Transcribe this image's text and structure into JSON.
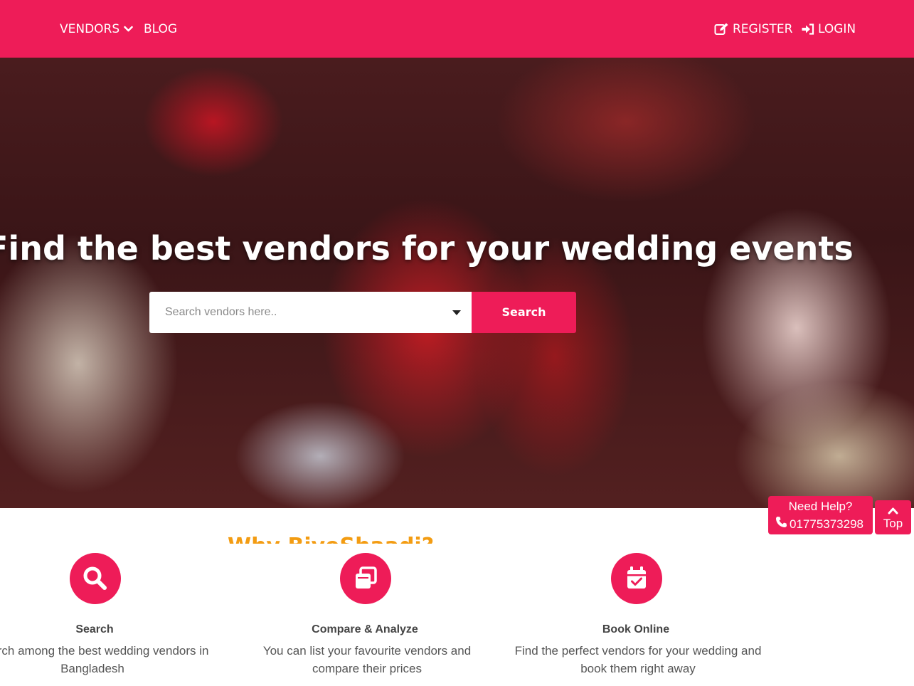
{
  "colors": {
    "brand": "#ee1c58",
    "heading_accent": "#f39c12",
    "white": "#ffffff"
  },
  "navbar": {
    "vendors_label": "VENDORS",
    "blog_label": "BLOG",
    "register_label": "REGISTER",
    "login_label": "LOGIN",
    "icons": [
      "chevron-down-icon",
      "edit-icon",
      "sign-in-icon"
    ]
  },
  "hero": {
    "title": "Find the best vendors for your wedding events",
    "search": {
      "placeholder": "Search vendors here..",
      "button_label": "Search"
    }
  },
  "section": {
    "heading": "Why BiyeShaadi?",
    "features": [
      {
        "icon": "search-icon",
        "title": "Search",
        "description": "Search among the best wedding vendors in Bangladesh"
      },
      {
        "icon": "clone-icon",
        "title": "Compare & Analyze",
        "description": "You can list your favourite vendors and compare their prices"
      },
      {
        "icon": "calendar-check-icon",
        "title": "Book Online",
        "description": "Find the perfect vendors for your wedding and book them right away"
      }
    ]
  },
  "help": {
    "title": "Need Help?",
    "phone": "01775373298",
    "top_label": "Top"
  }
}
